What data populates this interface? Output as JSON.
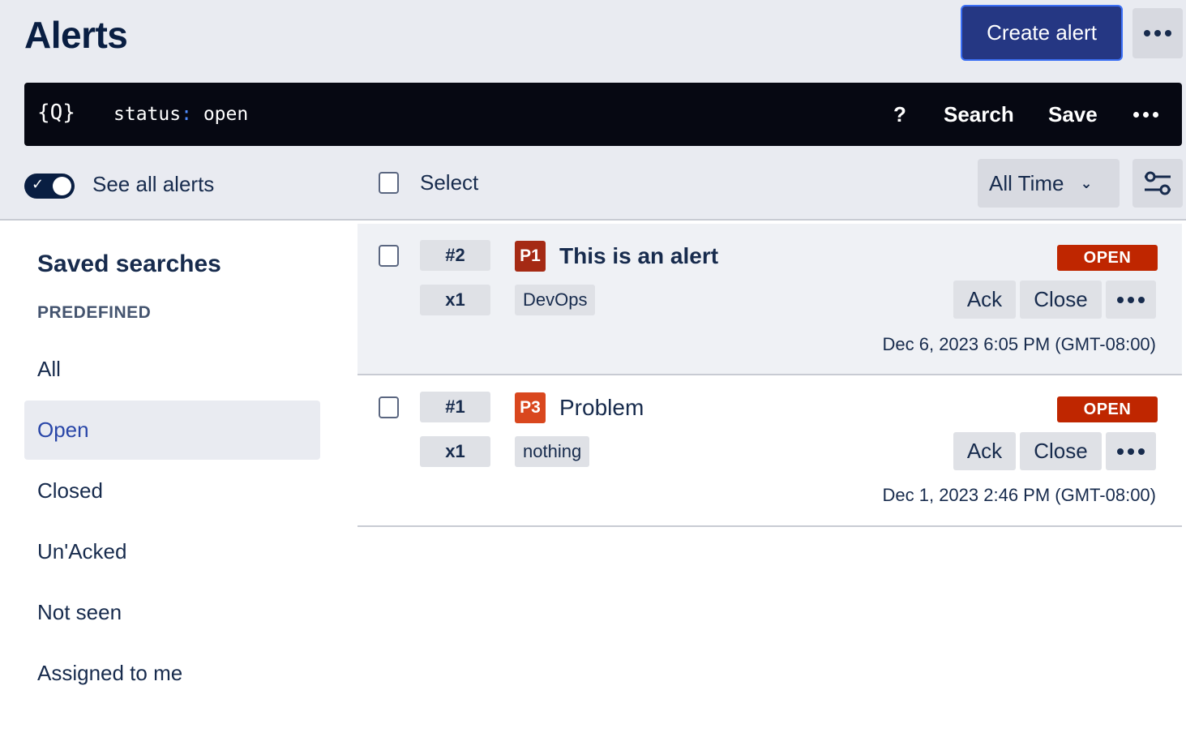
{
  "header": {
    "title": "Alerts",
    "create_label": "Create alert",
    "more_icon": "more-icon"
  },
  "search": {
    "icon": "query-braces-icon",
    "icon_text": "{Q}",
    "query_key": "status",
    "query_sep": ":",
    "query_value": "open",
    "help_label": "?",
    "search_label": "Search",
    "save_label": "Save"
  },
  "toolbar": {
    "toggle_on": true,
    "see_all_label": "See all alerts",
    "select_label": "Select",
    "time_filter": "All Time"
  },
  "sidebar": {
    "title": "Saved searches",
    "section": "PREDEFINED",
    "items": [
      {
        "label": "All",
        "active": false
      },
      {
        "label": "Open",
        "active": true
      },
      {
        "label": "Closed",
        "active": false
      },
      {
        "label": "Un'Acked",
        "active": false
      },
      {
        "label": "Not seen",
        "active": false
      },
      {
        "label": "Assigned to me",
        "active": false
      }
    ]
  },
  "alerts": [
    {
      "number": "#2",
      "count": "x1",
      "priority": "P1",
      "priority_color": "#a52a14",
      "title": "This is an alert",
      "title_bold": true,
      "status": "OPEN",
      "tag": "DevOps",
      "ack_label": "Ack",
      "close_label": "Close",
      "date": "Dec 6, 2023 6:05 PM (GMT-08:00)"
    },
    {
      "number": "#1",
      "count": "x1",
      "priority": "P3",
      "priority_color": "#d9471e",
      "title": "Problem",
      "title_bold": false,
      "status": "OPEN",
      "tag": "nothing",
      "ack_label": "Ack",
      "close_label": "Close",
      "date": "Dec 1, 2023 2:46 PM (GMT-08:00)"
    }
  ],
  "colors": {
    "accent": "#253783",
    "header_bg": "#e9ebf1",
    "search_bg": "#060812",
    "status_open": "#bf2600",
    "active_text": "#2946a8"
  }
}
